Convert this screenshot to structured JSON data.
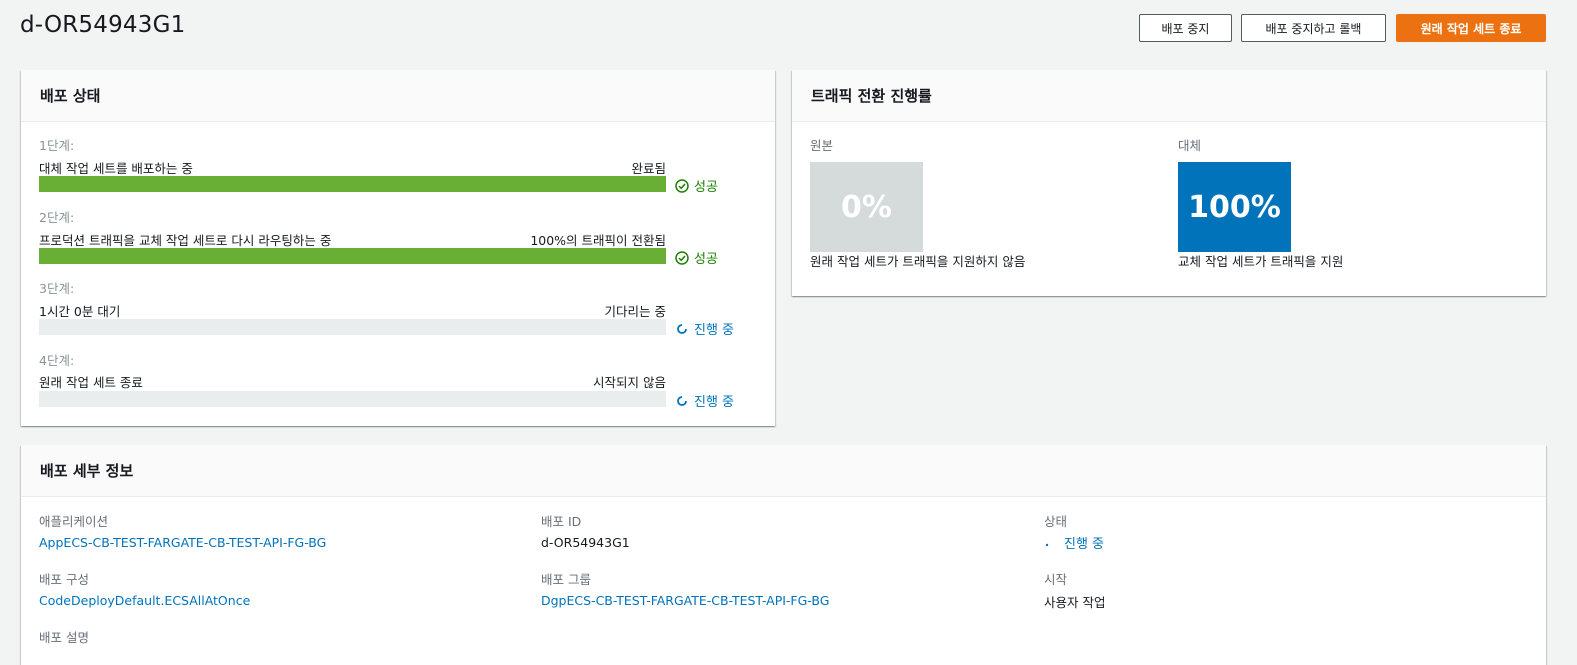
{
  "header": {
    "title": "d-OR54943G1",
    "buttons": {
      "stop": "배포 중지",
      "stop_rollback": "배포 중지하고 롤백",
      "terminate": "원래 작업 세트 종료"
    }
  },
  "status_panel": {
    "title": "배포 상태",
    "steps": [
      {
        "label": "1단계:",
        "desc": "대체 작업 세트를 배포하는 중",
        "right": "완료됨",
        "progress": 1.0,
        "status": "성공",
        "status_type": "success"
      },
      {
        "label": "2단계:",
        "desc": "프로덕션 트래픽을 교체 작업 세트로 다시 라우팅하는 중",
        "right": "100%의 트래픽이 전환됨",
        "progress": 1.0,
        "status": "성공",
        "status_type": "success"
      },
      {
        "label": "3단계:",
        "desc": "1시간 0분 대기",
        "right": "기다리는 중",
        "progress": 0.0,
        "status": "진행 중",
        "status_type": "progress"
      },
      {
        "label": "4단계:",
        "desc": "원래 작업 세트 종료",
        "right": "시작되지 않음",
        "progress": 0.0,
        "status": "진행 중",
        "status_type": "progress"
      }
    ]
  },
  "traffic_panel": {
    "title": "트래픽 전환 진행률",
    "original": {
      "label": "원본",
      "percent": "0%",
      "caption": "원래 작업 세트가 트래픽을 지원하지 않음",
      "color": "#d5dbdb"
    },
    "replacement": {
      "label": "대체",
      "percent": "100%",
      "caption": "교체 작업 세트가 트래픽을 지원",
      "color": "#0073bb"
    }
  },
  "details_panel": {
    "title": "배포 세부 정보",
    "application": {
      "label": "애플리케이션",
      "value": "AppECS-CB-TEST-FARGATE-CB-TEST-API-FG-BG"
    },
    "deployment_id": {
      "label": "배포 ID",
      "value": "d-OR54943G1"
    },
    "status": {
      "label": "상태",
      "value": "진행 중"
    },
    "config": {
      "label": "배포 구성",
      "value": "CodeDeployDefault.ECSAllAtOnce"
    },
    "group": {
      "label": "배포 그룹",
      "value": "DgpECS-CB-TEST-FARGATE-CB-TEST-API-FG-BG"
    },
    "initiated": {
      "label": "시작",
      "value": "사용자 작업"
    },
    "description": {
      "label": "배포 설명"
    }
  },
  "colors": {
    "accent": "#ec7211",
    "success": "#1d8102",
    "link": "#0073bb",
    "bar_fill": "#6aaf35"
  }
}
